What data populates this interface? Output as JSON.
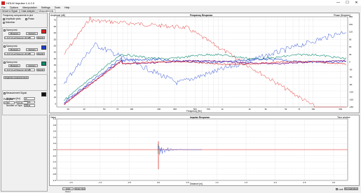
{
  "window": {
    "title": "HOLM Impulse 1.4.2.0",
    "minimize": "—",
    "maximize": "☐",
    "close": "✕"
  },
  "menu": [
    "File",
    "Options",
    "Manipulation",
    "Settings",
    "Tools",
    "Help"
  ],
  "tabs": [
    "Device & Signal",
    "Data analysis",
    "Measurements"
  ],
  "left": {
    "group_title": "Frequency components to plot",
    "amplitude": "Amplitude plots",
    "phase": "Phase",
    "distortion": "Distortion",
    "channels": [
      {
        "name": "Sweep test",
        "measure": "Measure",
        "options": "Options",
        "sel": "L & R 1/Log(Sweeps) Hi(1dB)",
        "export": "Export",
        "color": "#e02020"
      },
      {
        "name": "Sweep test",
        "measure": "Measure",
        "options": "Options",
        "sel": "L & R 1/Log(Sweeps) Hi(1dB)",
        "export": "Export",
        "color": "#1a3ed0"
      },
      {
        "name": "Sweep test",
        "measure": "Measure",
        "options": "Options",
        "sel": "L & R 1/Log(Sweeps) Hi(1dB)",
        "export": "Export",
        "color": "#0f8a70"
      }
    ],
    "organize": "Organize measurements",
    "measurement_signal": "Measurement Signal",
    "hp_label": "Highpass [Hz]",
    "lp_label": "Lowpass [Hz]",
    "taps_label": "Number of Taps",
    "hp_val": "20",
    "lp_val": "20000",
    "taps_val": "65536",
    "peak_label": "Peak pos.",
    "peak_val": "0.000",
    "peak_val2": "11.00"
  },
  "freq_chart": {
    "title": "Frequency Response",
    "ylabel": "Amplitude [dB]",
    "y2label": "Phase [Degrees]",
    "xlabel": "Frequency [Hz]",
    "x_ticks": [
      "20",
      "30",
      "50",
      "70",
      "100",
      "200",
      "300",
      "500",
      "700",
      "1k",
      "2k",
      "3k",
      "5k",
      "7k",
      "10k",
      "20k"
    ],
    "y_ticks": [
      "70",
      "65",
      "60",
      "55",
      "50",
      "45",
      "40",
      "35",
      "30",
      "25",
      "20",
      "15",
      "10",
      "5"
    ],
    "y2_ticks": [
      "180",
      "150",
      "120",
      "90",
      "60",
      "30",
      "0",
      "-30",
      "-60",
      "-90",
      "-120",
      "-150",
      "-180"
    ]
  },
  "imp_chart": {
    "title": "Impulse Response",
    "ylabel": "Value",
    "y2label": "Time window",
    "xlabel": "Distance [m]",
    "y_ticks": [
      "1.0",
      "0.8",
      "0.6",
      "0.4",
      "0.2",
      "0.0",
      "-0.2",
      "-0.4",
      "-0.6",
      "-0.8",
      "-1.0"
    ],
    "x_ticks": [
      "-1.5",
      "-1.0",
      "-0.5",
      "0.0",
      "0.5",
      "1.0",
      "1.5",
      "2.0",
      "2.5",
      "3.0"
    ]
  },
  "bottom": {
    "auto_zoom": "Auto Zoom",
    "zoom_out": "Zoom Out",
    "lock": "Lock",
    "normalization": "Normalization"
  },
  "colors": {
    "red": "#e02020",
    "blue": "#1a3ed0",
    "green": "#0f8a70",
    "purple": "#7a1a8a"
  }
}
